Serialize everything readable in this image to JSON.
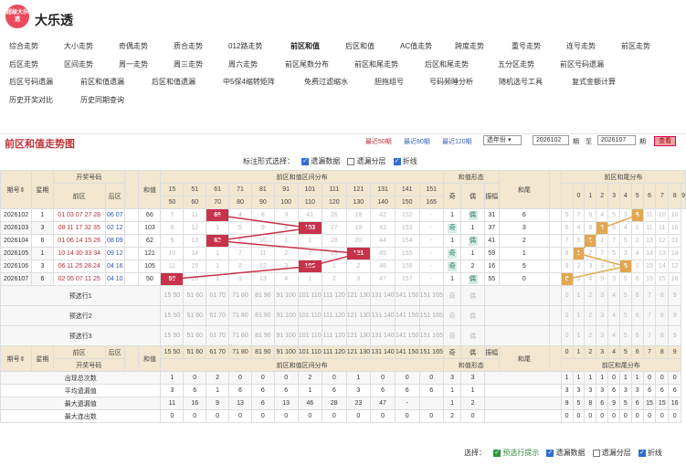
{
  "app": {
    "logo_text": "超级大乐透",
    "title": "大乐透"
  },
  "nav": [
    [
      "综合走势",
      "大小走势",
      "奇偶走势",
      "质合走势",
      "012路走势",
      "前区和值",
      "后区和值",
      "AC值走势",
      "跨度走势",
      "重号走势",
      "连号走势",
      "前区走势"
    ],
    [
      "后区走势",
      "区间走势",
      "周一走势",
      "周三走势",
      "周六走势",
      "前区尾数分布",
      "前区和尾走势",
      "后区和尾走势",
      "五分区走势",
      "前区号码遗漏"
    ],
    [
      "后区号码遗漏",
      "前区和值遗漏",
      "后区和值遗漏",
      "中5保4缩转矩阵",
      "免费过滤缩水",
      "胆拖组号",
      "号码频睡分析",
      "随机选号工具",
      "复式金额计算"
    ],
    [
      "历史开奖对比",
      "历史同期查询"
    ]
  ],
  "nav_active": "前区和值",
  "panel": {
    "title": "前区和值走势图",
    "recent50": "最近50期",
    "recent80": "最近80期",
    "recent120": "最近120期",
    "select_period": "选年份",
    "from": "2026102",
    "to_label": "至",
    "to": "2026107",
    "period_suffix": "期",
    "query": "查看"
  },
  "marks": {
    "label": "标注形式选择：",
    "opt1": "遗漏数据",
    "opt2": "遗漏分层",
    "opt3": "折线"
  },
  "headers": {
    "issue": "期号",
    "weekday": "星期",
    "draw": "开奖号码",
    "front": "前区",
    "back": "后区",
    "sum": "和值",
    "dist": "前区和值区间分布",
    "shape": "和值形态",
    "odd": "奇",
    "even": "偶",
    "pos": "振幅",
    "tail": "和尾",
    "tail_dist": "前区和尾分布"
  },
  "ranges": [
    [
      "15",
      "50"
    ],
    [
      "51",
      "60"
    ],
    [
      "61",
      "70"
    ],
    [
      "71",
      "80"
    ],
    [
      "81",
      "90"
    ],
    [
      "91",
      "100"
    ],
    [
      "101",
      "110"
    ],
    [
      "111",
      "120"
    ],
    [
      "121",
      "130"
    ],
    [
      "131",
      "140"
    ],
    [
      "141",
      "150"
    ],
    [
      "151",
      "165"
    ]
  ],
  "rows": [
    {
      "issue": "2026102",
      "wd": "1",
      "front": "01 03 07 27 28",
      "back": "06 07",
      "sum": "66",
      "cells": [
        "7",
        "11",
        "66",
        "4",
        "8",
        "3",
        "41",
        "26",
        "18",
        "42",
        "152",
        "-"
      ],
      "hit": 2,
      "shape": [
        "1",
        "偶",
        "31"
      ],
      "shape_hit": 1,
      "tail": "6",
      "tails": [
        "5",
        "7",
        "6",
        "4",
        "5",
        "3",
        "6",
        "11",
        "10",
        "10"
      ],
      "tail_hit": 6
    },
    {
      "issue": "2026103",
      "wd": "3",
      "front": "08 11 17 32 35",
      "back": "02 12",
      "sum": "103",
      "cells": [
        "8",
        "12",
        "1",
        "5",
        "9",
        "4",
        "103",
        "27",
        "19",
        "43",
        "153",
        "-"
      ],
      "hit": 6,
      "shape": [
        "奇",
        "1",
        "37"
      ],
      "shape_hit": 0,
      "tail": "3",
      "tails": [
        "6",
        "4",
        "8",
        "3",
        "6",
        "4",
        "1",
        "11",
        "11",
        "10"
      ],
      "tail_hit": 3
    },
    {
      "issue": "2026104",
      "wd": "6",
      "front": "01 06 14 15 26",
      "back": "08 09",
      "sum": "62",
      "cells": [
        "9",
        "13",
        "62",
        "6",
        "10",
        "1",
        "1",
        "28",
        "20",
        "44",
        "154",
        "-"
      ],
      "hit": 2,
      "shape": [
        "1",
        "偶",
        "41"
      ],
      "shape_hit": 1,
      "tail": "2",
      "tails": [
        "7",
        "5",
        "2",
        "1",
        "7",
        "5",
        "2",
        "13",
        "12",
        "11"
      ],
      "tail_hit": 2
    },
    {
      "issue": "2026105",
      "wd": "1",
      "front": "10 14 30 33 34",
      "back": "09 12",
      "sum": "121",
      "cells": [
        "10",
        "14",
        "1",
        "7",
        "11",
        "2",
        "2",
        "29",
        "121",
        "45",
        "155",
        "-"
      ],
      "hit": 8,
      "shape": [
        "奇",
        "1",
        "59"
      ],
      "shape_hit": 0,
      "tail": "1",
      "tails": [
        "8",
        "1",
        "2",
        "7",
        "5",
        "3",
        "4",
        "14",
        "13",
        "14"
      ],
      "tail_hit": 1
    },
    {
      "issue": "2026106",
      "wd": "3",
      "front": "06 11 25 28 24",
      "back": "04 16",
      "sum": "105",
      "cells": [
        "11",
        "15",
        "1",
        "8",
        "12",
        "3",
        "105",
        "1",
        "2",
        "46",
        "156",
        "-"
      ],
      "hit": 6,
      "shape": [
        "奇",
        "2",
        "16"
      ],
      "shape_hit": 0,
      "tail": "5",
      "tails": [
        "9",
        "2",
        "3",
        "3",
        "4",
        "5",
        "1",
        "15",
        "14",
        "12"
      ],
      "tail_hit": 5
    },
    {
      "issue": "2026107",
      "wd": "6",
      "front": "02 05 07 11 25",
      "back": "04 10",
      "sum": "50",
      "cells": [
        "50",
        "16",
        "1",
        "9",
        "13",
        "4",
        "1",
        "2",
        "3",
        "47",
        "157",
        "-"
      ],
      "hit": 0,
      "shape": [
        "1",
        "偶",
        "55"
      ],
      "shape_hit": 1,
      "tail": "0",
      "tails": [
        "0",
        "3",
        "4",
        "9",
        "3",
        "5",
        "6",
        "15",
        "15",
        "16"
      ],
      "tail_hit": 0
    }
  ],
  "preview": [
    "预选行1",
    "预选行2",
    "预选行3"
  ],
  "stats": [
    {
      "label": "出现总次数",
      "cells": [
        "1",
        "0",
        "2",
        "0",
        "0",
        "0",
        "2",
        "0",
        "1",
        "0",
        "0",
        "0"
      ],
      "shape": [
        "3",
        "3"
      ],
      "tails": [
        "1",
        "1",
        "1",
        "1",
        "0",
        "1",
        "1",
        "0",
        "0",
        "0"
      ]
    },
    {
      "label": "平均遗漏值",
      "cells": [
        "3",
        "6",
        "1",
        "6",
        "6",
        "6",
        "1",
        "6",
        "3",
        "6",
        "6",
        "6"
      ],
      "shape": [
        "1",
        "1"
      ],
      "tails": [
        "3",
        "3",
        "3",
        "3",
        "6",
        "3",
        "3",
        "6",
        "6",
        "6"
      ]
    },
    {
      "label": "最大遗漏值",
      "cells": [
        "11",
        "16",
        "9",
        "13",
        "6",
        "13",
        "46",
        "28",
        "23",
        "47",
        "-",
        ""
      ],
      "shape": [
        "1",
        "2"
      ],
      "tails": [
        "9",
        "5",
        "8",
        "6",
        "9",
        "5",
        "6",
        "15",
        "15",
        "16"
      ]
    },
    {
      "label": "最大连出数",
      "cells": [
        "0",
        "0",
        "0",
        "0",
        "0",
        "0",
        "0",
        "0",
        "0",
        "0",
        "0",
        "0"
      ],
      "shape": [
        "2",
        "0"
      ],
      "tails": [
        "0",
        "0",
        "0",
        "0",
        "0",
        "0",
        "0",
        "0",
        "0",
        "0"
      ]
    }
  ],
  "bottom": {
    "label": "选择：",
    "o1": "预选行提示",
    "o2": "遗漏数据",
    "o3": "遗漏分层",
    "o4": "折线"
  },
  "colors": {
    "hit": "#c8324a",
    "tail_hit": "#e0a851",
    "header": "#f3e7cf"
  }
}
